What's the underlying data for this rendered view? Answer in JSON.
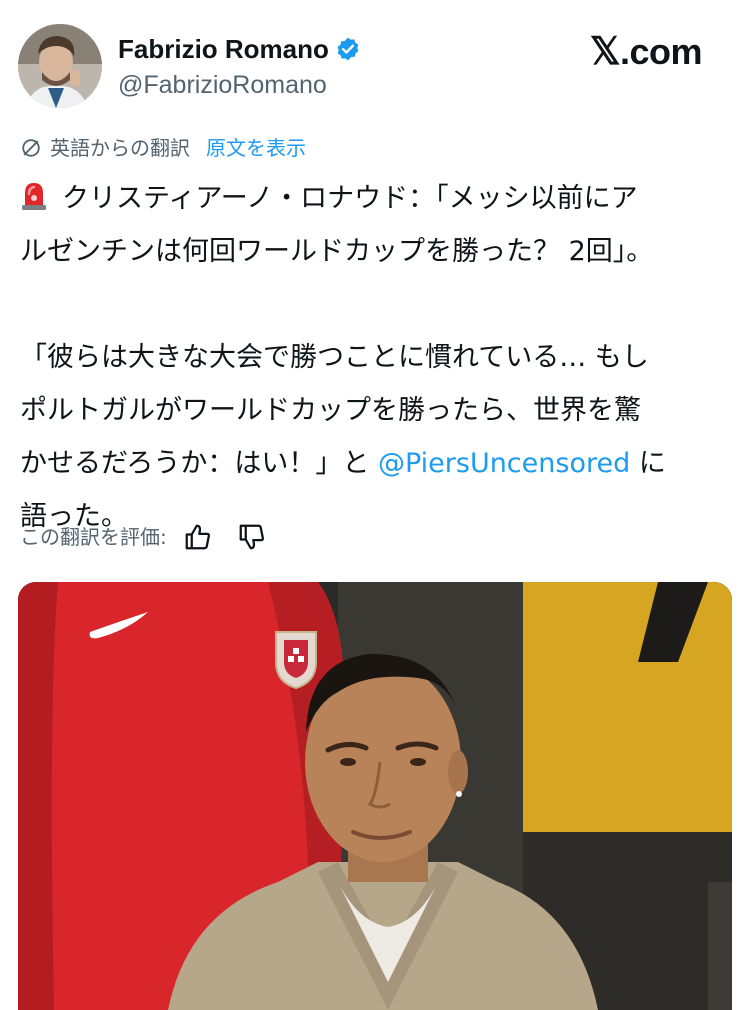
{
  "author": {
    "display_name": "Fabrizio Romano",
    "handle": "@FabrizioRomano",
    "verified": true,
    "avatar_icon": "profile-photo"
  },
  "brand": {
    "logo": "𝕏",
    "label": ".com"
  },
  "translation": {
    "icon": "globe-icon",
    "translated_from": "英語からの翻訳",
    "show_original": "原文を表示"
  },
  "tweet": {
    "emoji": "rotating-light",
    "line1": "クリスティアーノ・ロナウド：「メッシ以前にア",
    "line2": "ルゼンチンは何回ワールドカップを勝った？ 2回」。",
    "line3": "「彼らは大きな大会で勝つことに慣れている… もし",
    "line4": "ポルトガルがワールドカップを勝ったら、世界を驚",
    "line5_before": "かせるだろうか：はい！」と ",
    "mention": "@PiersUncensored",
    "line5_after": " に",
    "line6": "語った。"
  },
  "rate": {
    "label": "この翻訳を評価:",
    "like_icon": "thumbs-up-icon",
    "dislike_icon": "thumbs-down-icon"
  },
  "colors": {
    "text": "#0f1419",
    "secondary": "#536471",
    "link": "#1d9bf0",
    "verified": "#1d9bf0"
  }
}
